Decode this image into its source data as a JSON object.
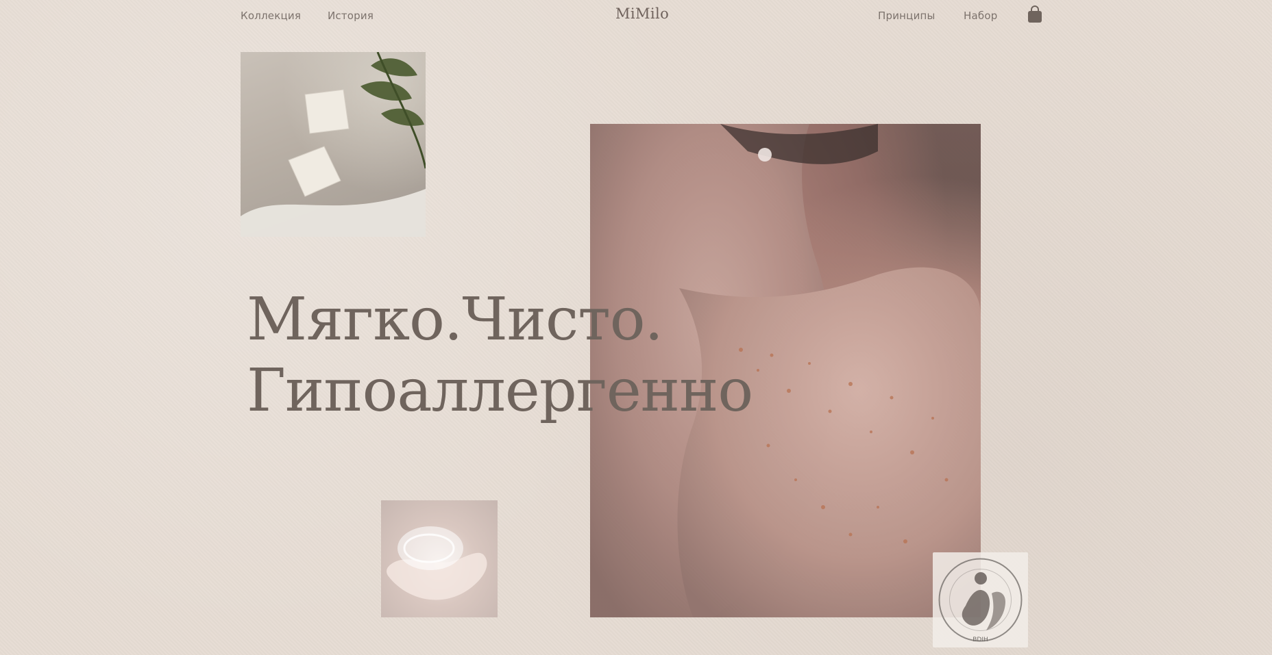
{
  "nav": {
    "left": [
      {
        "label": "Коллекция"
      },
      {
        "label": "История"
      }
    ],
    "brand": "MiMilo",
    "right": [
      {
        "label": "Принципы"
      },
      {
        "label": "Набор"
      }
    ],
    "cart_icon": "shopping-bag-icon"
  },
  "hero": {
    "headline_line1": "Мягко.Чисто.",
    "headline_line2": "Гипоаллергенно"
  },
  "images": {
    "soap": {
      "subject": "soap-bars-with-leaves"
    },
    "hand": {
      "subject": "hand-with-foam"
    },
    "shoulder": {
      "subject": "freckled-shoulder-portrait"
    }
  },
  "badge": {
    "ring_text": "International Organic and Natural Cosmetics Corporation",
    "bottom_text": "BDIH"
  },
  "colors": {
    "background": "#e6dcd3",
    "text": "#7c726c",
    "headline": "#6f645d"
  }
}
